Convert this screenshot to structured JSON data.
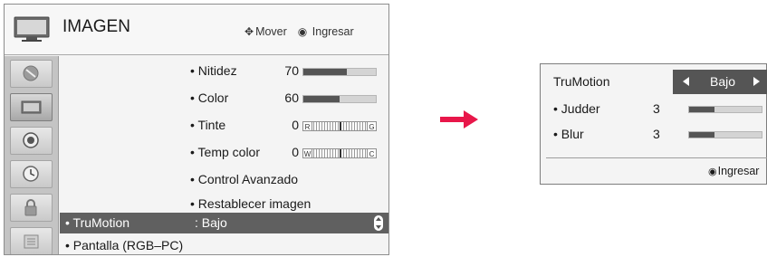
{
  "menu": {
    "title": "IMAGEN",
    "hint_move_icon": "move-arrows-icon",
    "hint_move": "Mover",
    "hint_enter_icon": "ok-circle-icon",
    "hint_enter": "Ingresar",
    "sidebar_icons": [
      "satellite-dish-icon",
      "tv-picture-icon",
      "speaker-icon",
      "clock-icon",
      "lock-icon",
      "options-icon"
    ],
    "active_sidebar_index": 1,
    "items": [
      {
        "label": "• Nitidez",
        "value": "70",
        "level": 0.6
      },
      {
        "label": "• Color",
        "value": "60",
        "level": 0.5
      },
      {
        "label": "• Tinte",
        "value": "0",
        "left": "R",
        "right": "G"
      },
      {
        "label": "• Temp color",
        "value": "0",
        "left": "W",
        "right": "C"
      },
      {
        "label": "• Control Avanzado"
      },
      {
        "label": "• Restablecer imagen"
      }
    ],
    "selected": {
      "label": "• TruMotion",
      "value": ": Bajo"
    },
    "last": {
      "label": "• Pantalla (RGB–PC)"
    }
  },
  "arrow_color": "#e8174a",
  "popup": {
    "title": "TruMotion",
    "value": "Bajo",
    "rows": [
      {
        "label": "• Judder",
        "value": "3",
        "level": 0.35
      },
      {
        "label": "• Blur",
        "value": "3",
        "level": 0.35
      }
    ],
    "enter": "Ingresar"
  }
}
